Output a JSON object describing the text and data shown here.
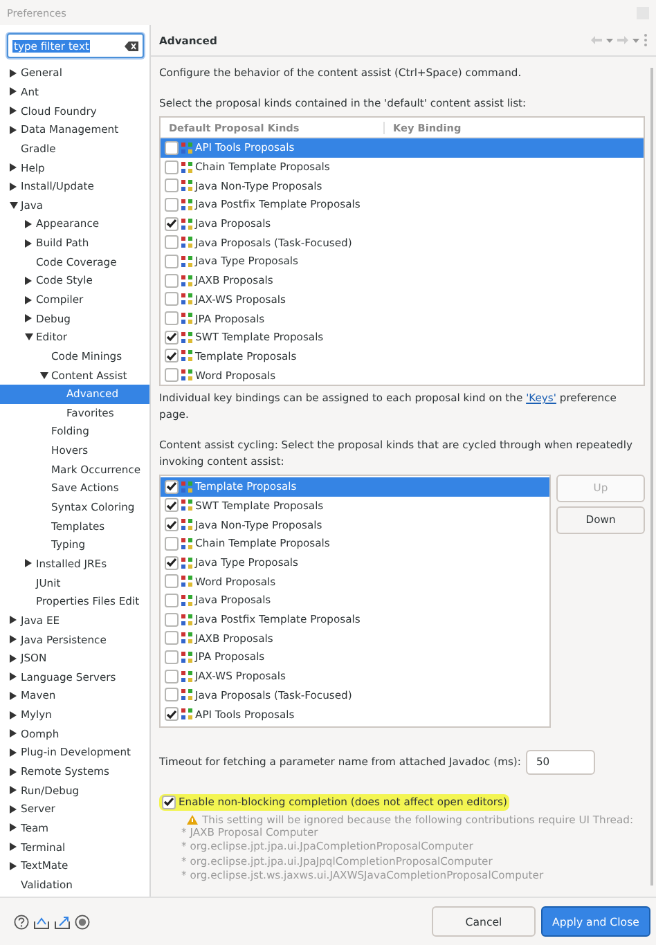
{
  "window": {
    "title": "Preferences"
  },
  "filter": {
    "value": "type filter text"
  },
  "tree": [
    {
      "label": "General",
      "expanded": false,
      "selected": false
    },
    {
      "label": "Ant",
      "expanded": false,
      "selected": false
    },
    {
      "label": "Cloud Foundry",
      "expanded": false,
      "selected": false
    },
    {
      "label": "Data Management",
      "expanded": false,
      "selected": false
    },
    {
      "label": "Gradle",
      "selected": false
    },
    {
      "label": "Help",
      "expanded": false,
      "selected": false
    },
    {
      "label": "Install/Update",
      "expanded": false,
      "selected": false
    },
    {
      "label": "Java",
      "expanded": true,
      "selected": false,
      "children": [
        {
          "label": "Appearance",
          "expanded": false,
          "selected": false
        },
        {
          "label": "Build Path",
          "expanded": false,
          "selected": false
        },
        {
          "label": "Code Coverage",
          "selected": false
        },
        {
          "label": "Code Style",
          "expanded": false,
          "selected": false
        },
        {
          "label": "Compiler",
          "expanded": false,
          "selected": false
        },
        {
          "label": "Debug",
          "expanded": false,
          "selected": false
        },
        {
          "label": "Editor",
          "expanded": true,
          "selected": false,
          "children": [
            {
              "label": "Code Minings",
              "selected": false
            },
            {
              "label": "Content Assist",
              "expanded": true,
              "selected": false,
              "children": [
                {
                  "label": "Advanced",
                  "selected": true
                },
                {
                  "label": "Favorites",
                  "selected": false
                }
              ]
            },
            {
              "label": "Folding",
              "selected": false
            },
            {
              "label": "Hovers",
              "selected": false
            },
            {
              "label": "Mark Occurrence",
              "selected": false
            },
            {
              "label": "Save Actions",
              "selected": false
            },
            {
              "label": "Syntax Coloring",
              "selected": false
            },
            {
              "label": "Templates",
              "selected": false
            },
            {
              "label": "Typing",
              "selected": false
            }
          ]
        },
        {
          "label": "Installed JREs",
          "expanded": false,
          "selected": false
        },
        {
          "label": "JUnit",
          "selected": false
        },
        {
          "label": "Properties Files Edit",
          "selected": false
        }
      ]
    },
    {
      "label": "Java EE",
      "expanded": false,
      "selected": false
    },
    {
      "label": "Java Persistence",
      "expanded": false,
      "selected": false
    },
    {
      "label": "JSON",
      "expanded": false,
      "selected": false
    },
    {
      "label": "Language Servers",
      "expanded": false,
      "selected": false
    },
    {
      "label": "Maven",
      "expanded": false,
      "selected": false
    },
    {
      "label": "Mylyn",
      "expanded": false,
      "selected": false
    },
    {
      "label": "Oomph",
      "expanded": false,
      "selected": false
    },
    {
      "label": "Plug-in Development",
      "expanded": false,
      "selected": false
    },
    {
      "label": "Remote Systems",
      "expanded": false,
      "selected": false
    },
    {
      "label": "Run/Debug",
      "expanded": false,
      "selected": false
    },
    {
      "label": "Server",
      "expanded": false,
      "selected": false
    },
    {
      "label": "Team",
      "expanded": false,
      "selected": false
    },
    {
      "label": "Terminal",
      "expanded": false,
      "selected": false
    },
    {
      "label": "TextMate",
      "expanded": false,
      "selected": false
    },
    {
      "label": "Validation",
      "selected": false
    }
  ],
  "page": {
    "title": "Advanced",
    "description": "Configure the behavior of the content assist (Ctrl+Space) command.",
    "default_list": {
      "label": "Select the proposal kinds contained in the 'default' content assist list:",
      "columns": [
        "Default Proposal Kinds",
        "Key Binding"
      ],
      "rows": [
        {
          "label": "API Tools Proposals",
          "checked": false,
          "selected": true
        },
        {
          "label": "Chain Template Proposals",
          "checked": false,
          "selected": false
        },
        {
          "label": "Java Non-Type Proposals",
          "checked": false,
          "selected": false
        },
        {
          "label": "Java Postfix Template Proposals",
          "checked": false,
          "selected": false
        },
        {
          "label": "Java Proposals",
          "checked": true,
          "selected": false
        },
        {
          "label": "Java Proposals (Task-Focused)",
          "checked": false,
          "selected": false
        },
        {
          "label": "Java Type Proposals",
          "checked": false,
          "selected": false
        },
        {
          "label": "JAXB Proposals",
          "checked": false,
          "selected": false
        },
        {
          "label": "JAX-WS Proposals",
          "checked": false,
          "selected": false
        },
        {
          "label": "JPA Proposals",
          "checked": false,
          "selected": false
        },
        {
          "label": "SWT Template Proposals",
          "checked": true,
          "selected": false
        },
        {
          "label": "Template Proposals",
          "checked": true,
          "selected": false
        },
        {
          "label": "Word Proposals",
          "checked": false,
          "selected": false
        }
      ]
    },
    "keys_note": {
      "before": "Individual key bindings can be assigned to each proposal kind on the",
      "link": "'Keys'",
      "after": "preference page."
    },
    "cycling": {
      "label": "Content assist cycling: Select the proposal kinds that are cycled through when repeatedly invoking content assist:",
      "rows": [
        {
          "label": "Template Proposals",
          "checked": true,
          "selected": true
        },
        {
          "label": "SWT Template Proposals",
          "checked": true,
          "selected": false
        },
        {
          "label": "Java Non-Type Proposals",
          "checked": true,
          "selected": false
        },
        {
          "label": "Chain Template Proposals",
          "checked": false,
          "selected": false
        },
        {
          "label": "Java Type Proposals",
          "checked": true,
          "selected": false
        },
        {
          "label": "Word Proposals",
          "checked": false,
          "selected": false
        },
        {
          "label": "Java Proposals",
          "checked": false,
          "selected": false
        },
        {
          "label": "Java Postfix Template Proposals",
          "checked": false,
          "selected": false
        },
        {
          "label": "JAXB Proposals",
          "checked": false,
          "selected": false
        },
        {
          "label": "JPA Proposals",
          "checked": false,
          "selected": false
        },
        {
          "label": "JAX-WS Proposals",
          "checked": false,
          "selected": false
        },
        {
          "label": "Java Proposals (Task-Focused)",
          "checked": false,
          "selected": false
        },
        {
          "label": "API Tools Proposals",
          "checked": true,
          "selected": false
        }
      ],
      "buttons": [
        {
          "label": "Up",
          "disabled": true
        },
        {
          "label": "Down",
          "disabled": false
        }
      ]
    },
    "timeout": {
      "label": "Timeout for fetching a parameter name from attached Javadoc (ms):",
      "value": "50"
    },
    "non_blocking": {
      "label": "Enable non-blocking completion (does not affect open editors)",
      "checked": true,
      "highlighted": true
    },
    "warning": {
      "text": "This setting will be ignored because the following contributions require UI Thread:",
      "items": [
        "* JAXB Proposal Computer",
        "* org.eclipse.jpt.jpa.ui.JpaCompletionProposalComputer",
        "* org.eclipse.jpt.jpa.ui.JpaJpqlCompletionProposalComputer",
        "* org.eclipse.jst.ws.jaxws.ui.JAXWSJavaCompletionProposalComputer"
      ]
    }
  },
  "buttons": [
    {
      "label": "Cancel",
      "kind": "secondary"
    },
    {
      "label": "Apply and Close",
      "kind": "primary"
    }
  ]
}
